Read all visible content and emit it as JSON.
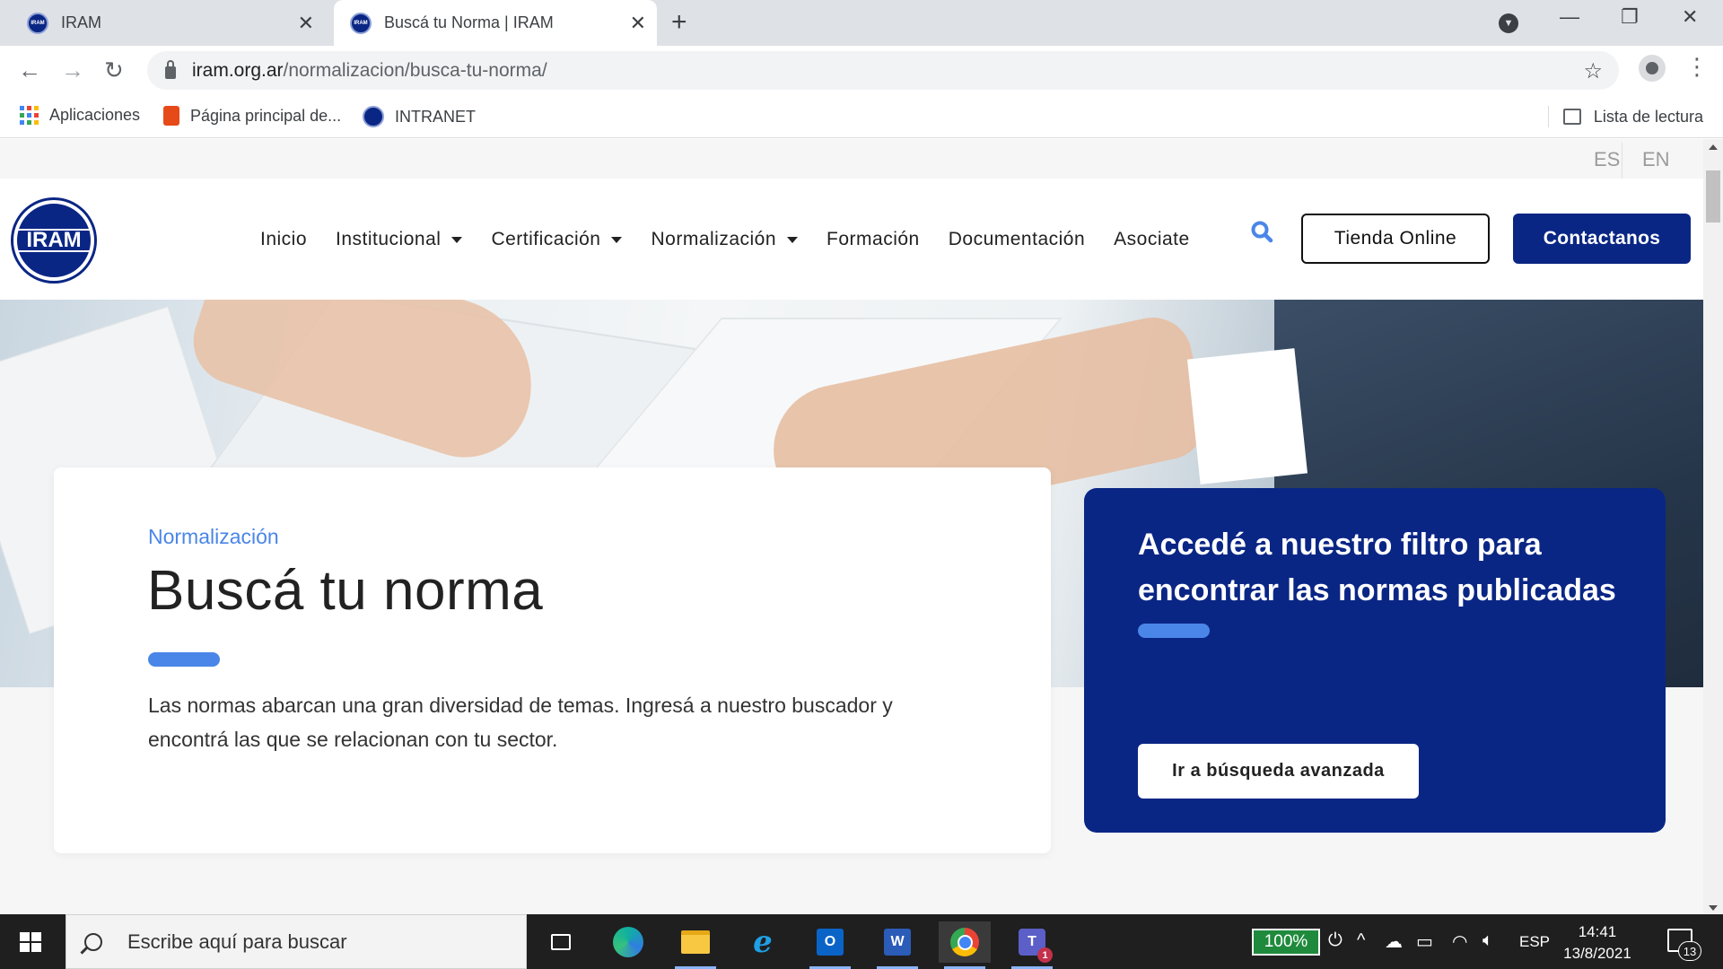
{
  "browser": {
    "tabs": [
      {
        "title": "IRAM",
        "active": false
      },
      {
        "title": "Buscá tu Norma | IRAM",
        "active": true
      }
    ],
    "url_host": "iram.org.ar",
    "url_path": "/normalizacion/busca-tu-norma/",
    "bookmarks": [
      {
        "label": "Aplicaciones",
        "icon": "apps-grid-icon"
      },
      {
        "label": "Página principal de...",
        "icon": "office-icon"
      },
      {
        "label": "INTRANET",
        "icon": "iram-favicon"
      }
    ],
    "reading_list": "Lista de lectura"
  },
  "site": {
    "languages": [
      "ES",
      "EN"
    ],
    "logo_text": "IRAM",
    "nav": [
      {
        "label": "Inicio",
        "dropdown": false
      },
      {
        "label": "Institucional",
        "dropdown": true
      },
      {
        "label": "Certificación",
        "dropdown": true
      },
      {
        "label": "Normalización",
        "dropdown": true
      },
      {
        "label": "Formación",
        "dropdown": false
      },
      {
        "label": "Documentación",
        "dropdown": false
      },
      {
        "label": "Asociate",
        "dropdown": false
      }
    ],
    "shop_button": "Tienda Online",
    "contact_button": "Contactanos",
    "colors": {
      "brand_blue": "#0a2685",
      "accent_blue": "#4a86e8"
    }
  },
  "hero": {
    "eyebrow": "Normalización",
    "title": "Buscá tu norma",
    "description": "Las normas abarcan una gran diversidad de temas. Ingresá a nuestro buscador y encontrá las que se relacionan con tu sector."
  },
  "promo": {
    "title": "Accedé a nuestro filtro para encontrar las normas publicadas",
    "button": "Ir a búsqueda avanzada"
  },
  "taskbar": {
    "search_placeholder": "Escribe aquí para buscar",
    "apps": [
      "task-view",
      "edge",
      "file-explorer",
      "internet-explorer",
      "outlook",
      "word",
      "chrome",
      "teams"
    ],
    "teams_badge": "1",
    "battery": "100%",
    "language": "ESP",
    "time": "14:41",
    "date": "13/8/2021",
    "notifications": "13"
  }
}
